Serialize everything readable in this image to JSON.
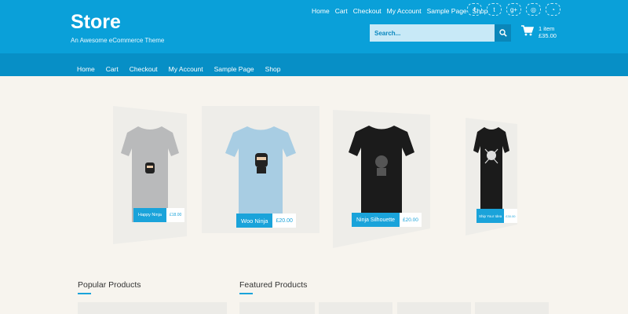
{
  "header": {
    "brand": "Store",
    "tagline": "An Awesome eCommerce Theme",
    "top_nav": [
      "Home",
      "Cart",
      "Checkout",
      "My Account",
      "Sample Page",
      "Shop"
    ],
    "social": [
      {
        "icon": "facebook-icon",
        "glyph": "f"
      },
      {
        "icon": "twitter-icon",
        "glyph": "t"
      },
      {
        "icon": "google-plus-icon",
        "glyph": "g+"
      },
      {
        "icon": "instagram-icon",
        "glyph": "◎"
      },
      {
        "icon": "rss-icon",
        "glyph": "◔"
      }
    ],
    "search_placeholder": "Search...",
    "cart_items": "1 item",
    "cart_total": "£35.00"
  },
  "main_nav": [
    "Home",
    "Cart",
    "Checkout",
    "My Account",
    "Sample Page",
    "Shop"
  ],
  "products": [
    {
      "name": "Happy Ninja",
      "price": "£18.00",
      "shirt_color": "#b9babb"
    },
    {
      "name": "Woo Ninja",
      "price": "£20.00",
      "shirt_color": "#a8cde3"
    },
    {
      "name": "Ninja Silhouette",
      "price": "£20.00",
      "shirt_color": "#1b1b1b"
    },
    {
      "name": "Ship Your Idea",
      "price": "£30.00",
      "shirt_color": "#1b1b1b"
    }
  ],
  "sections": {
    "popular": "Popular Products",
    "featured": "Featured Products"
  },
  "colors": {
    "header": "#0aa0d9",
    "nav": "#078fc6",
    "accent": "#1aa3da",
    "background": "#f7f4ee"
  }
}
